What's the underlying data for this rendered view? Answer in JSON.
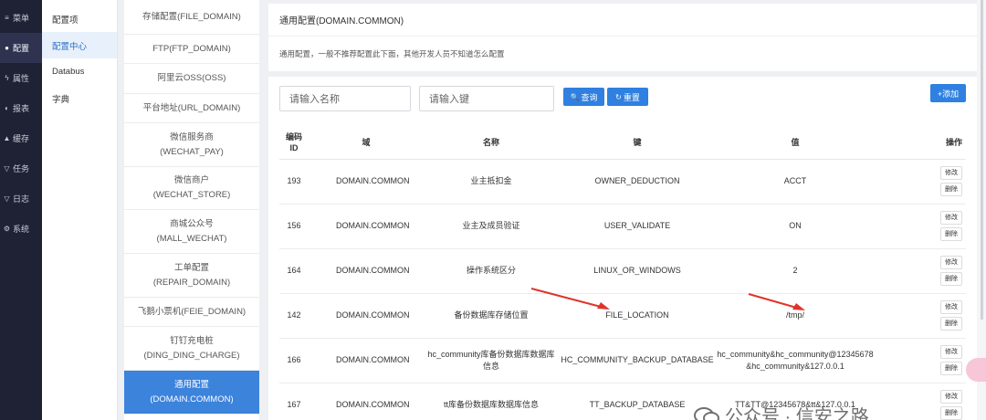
{
  "nav": {
    "items": [
      {
        "icon": "≡",
        "label": "菜单"
      },
      {
        "icon": "●",
        "label": "配置"
      },
      {
        "icon": "ϟ",
        "label": "属性"
      },
      {
        "icon": "◐",
        "label": "报表"
      },
      {
        "icon": "▲",
        "label": "缓存"
      },
      {
        "icon": "▽",
        "label": "任务"
      },
      {
        "icon": "▽",
        "label": "日志"
      },
      {
        "icon": "⚙",
        "label": "系统"
      }
    ]
  },
  "sub_nav": {
    "items": [
      {
        "label": "配置项"
      },
      {
        "label": "配置中心"
      },
      {
        "label": "Databus"
      },
      {
        "label": "字典"
      }
    ]
  },
  "domains": [
    {
      "line1": "存储配置(FILE_DOMAIN)",
      "line2": ""
    },
    {
      "line1": "FTP(FTP_DOMAIN)",
      "line2": ""
    },
    {
      "line1": "阿里云OSS(OSS)",
      "line2": ""
    },
    {
      "line1": "平台地址(URL_DOMAIN)",
      "line2": ""
    },
    {
      "line1": "微信服务商",
      "line2": "(WECHAT_PAY)"
    },
    {
      "line1": "微信商户",
      "line2": "(WECHAT_STORE)"
    },
    {
      "line1": "商城公众号",
      "line2": "(MALL_WECHAT)"
    },
    {
      "line1": "工单配置",
      "line2": "(REPAIR_DOMAIN)"
    },
    {
      "line1": "飞鹅小票机(FEIE_DOMAIN)",
      "line2": ""
    },
    {
      "line1": "钉钉充电桩",
      "line2": "(DING_DING_CHARGE)"
    },
    {
      "line1": "通用配置",
      "line2": "(DOMAIN.COMMON)"
    },
    {
      "line1": "",
      "line2": ""
    }
  ],
  "panel": {
    "title": "通用配置(DOMAIN.COMMON)",
    "description": "通用配置，一般不推荐配置此下面，其他开发人员不知道怎么配置"
  },
  "search": {
    "name_placeholder": "请输入名称",
    "key_placeholder": "请输入键",
    "query_icon": "🔍",
    "query_label": "查询",
    "reset_icon": "↻",
    "reset_label": "重置",
    "add_label": "+添加"
  },
  "table": {
    "headers": {
      "id1": "编码",
      "id2": "ID",
      "domain": "域",
      "name": "名称",
      "key": "键",
      "value": "值",
      "ops": "操作"
    },
    "rows": [
      {
        "id": "193",
        "domain": "DOMAIN.COMMON",
        "name": "业主抵扣金",
        "key": "OWNER_DEDUCTION",
        "value": "ACCT",
        "edit": "修改",
        "del": "删除"
      },
      {
        "id": "156",
        "domain": "DOMAIN.COMMON",
        "name": "业主及成员验证",
        "key": "USER_VALIDATE",
        "value": "ON",
        "edit": "修改",
        "del": "删除"
      },
      {
        "id": "164",
        "domain": "DOMAIN.COMMON",
        "name": "操作系统区分",
        "key": "LINUX_OR_WINDOWS",
        "value": "2",
        "edit": "修改",
        "del": "删除"
      },
      {
        "id": "142",
        "domain": "DOMAIN.COMMON",
        "name": "备份数据库存储位置",
        "key": "FILE_LOCATION",
        "value": "/tmp/",
        "edit": "修改",
        "del": "删除"
      },
      {
        "id": "166",
        "domain": "DOMAIN.COMMON",
        "name": "hc_community库备份数据库数据库信息",
        "key": "HC_COMMUNITY_BACKUP_DATABASE",
        "value": "hc_community&hc_community@12345678&hc_community&127.0.0.1",
        "edit": "修改",
        "del": "删除"
      },
      {
        "id": "167",
        "domain": "DOMAIN.COMMON",
        "name": "tt库备份数据库数据库信息",
        "key": "TT_BACKUP_DATABASE",
        "value": "TT&TT@12345678&tt&127.0.0.1",
        "edit": "修改",
        "del": "删除"
      }
    ]
  },
  "watermark": {
    "text": "公众号 · 信安之路"
  },
  "colors": {
    "accent": "#3c83dc",
    "arrow": "#e0342b",
    "nav_bg": "#1f2235"
  }
}
